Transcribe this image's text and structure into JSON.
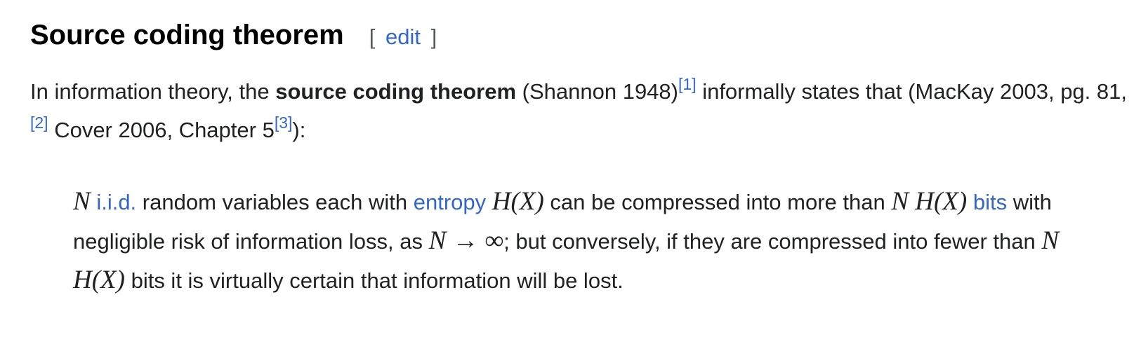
{
  "section": {
    "title": "Source coding theorem",
    "edit": {
      "open_bracket": "[",
      "label": "edit",
      "close_bracket": "]"
    }
  },
  "lead": {
    "t1": "In information theory, the ",
    "bold": "source coding theorem",
    "t2": " (Shannon 1948)",
    "ref1": "[1]",
    "t3": " informally states that (MacKay 2003, pg. 81,",
    "ref2": "[2]",
    "t4": " Cover 2006, Chapter 5",
    "ref3": "[3]",
    "t5": "):"
  },
  "quote": {
    "m1": "N",
    "link_iid": "i.i.d.",
    "t1": " random variables each with ",
    "link_entropy": "entropy",
    "m2": "H(X)",
    "t2": " can be compressed into more than ",
    "m3": "N H(X)",
    "link_bits": "bits",
    "t3": " with negligible risk of information loss, as ",
    "m4": "N → ∞",
    "t4": "; but conversely, if they are compressed into fewer than ",
    "m5": "N H(X)",
    "t5": " bits it is virtually certain that information will be lost."
  },
  "colors": {
    "link": "#3366cc",
    "text": "#202122",
    "heading": "#000000"
  }
}
